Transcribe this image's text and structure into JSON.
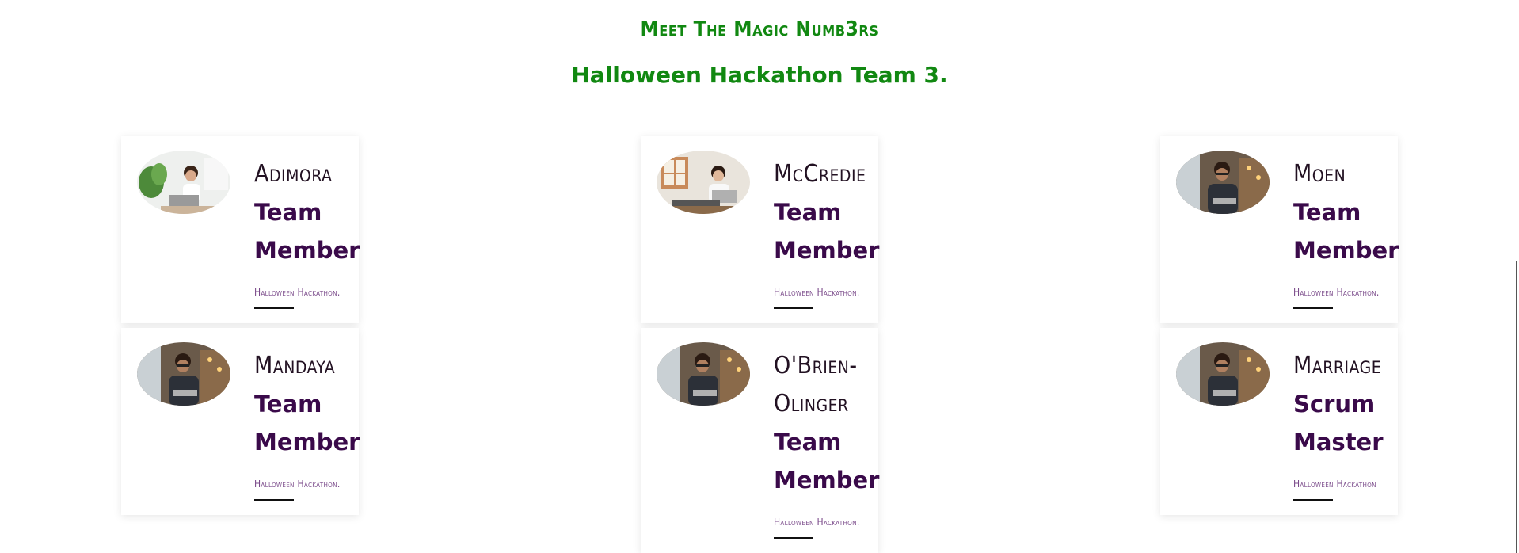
{
  "header": {
    "subtitle": "Meet The Magic Numb3rs",
    "title": "Halloween Hackathon Team 3."
  },
  "members": [
    {
      "name": "Adimora",
      "role": "Team Member",
      "org": "Halloween Hackathon.",
      "photo": "woman-laptop-plants-photo"
    },
    {
      "name": "McCredie",
      "role": "Team Member",
      "org": "Halloween Hackathon.",
      "photo": "woman-laptop-window-photo"
    },
    {
      "name": "Moen",
      "role": "Team Member",
      "org": "Halloween Hackathon.",
      "photo": "man-glasses-laptop-photo"
    },
    {
      "name": "Mandaya",
      "role": "Team Member",
      "org": "Halloween Hackathon.",
      "photo": "man-glasses-laptop-photo"
    },
    {
      "name": "O'Brien-Olinger",
      "role": "Team Member",
      "org": "Halloween Hackathon.",
      "photo": "man-glasses-laptop-photo"
    },
    {
      "name": "Marriage",
      "role": "Scrum Master",
      "org": "Halloween Hackathon",
      "photo": "man-glasses-laptop-photo"
    }
  ],
  "colors": {
    "header_green": "#118811",
    "role_purple": "#3a0a4a",
    "org_purple": "#7a4a8a"
  }
}
